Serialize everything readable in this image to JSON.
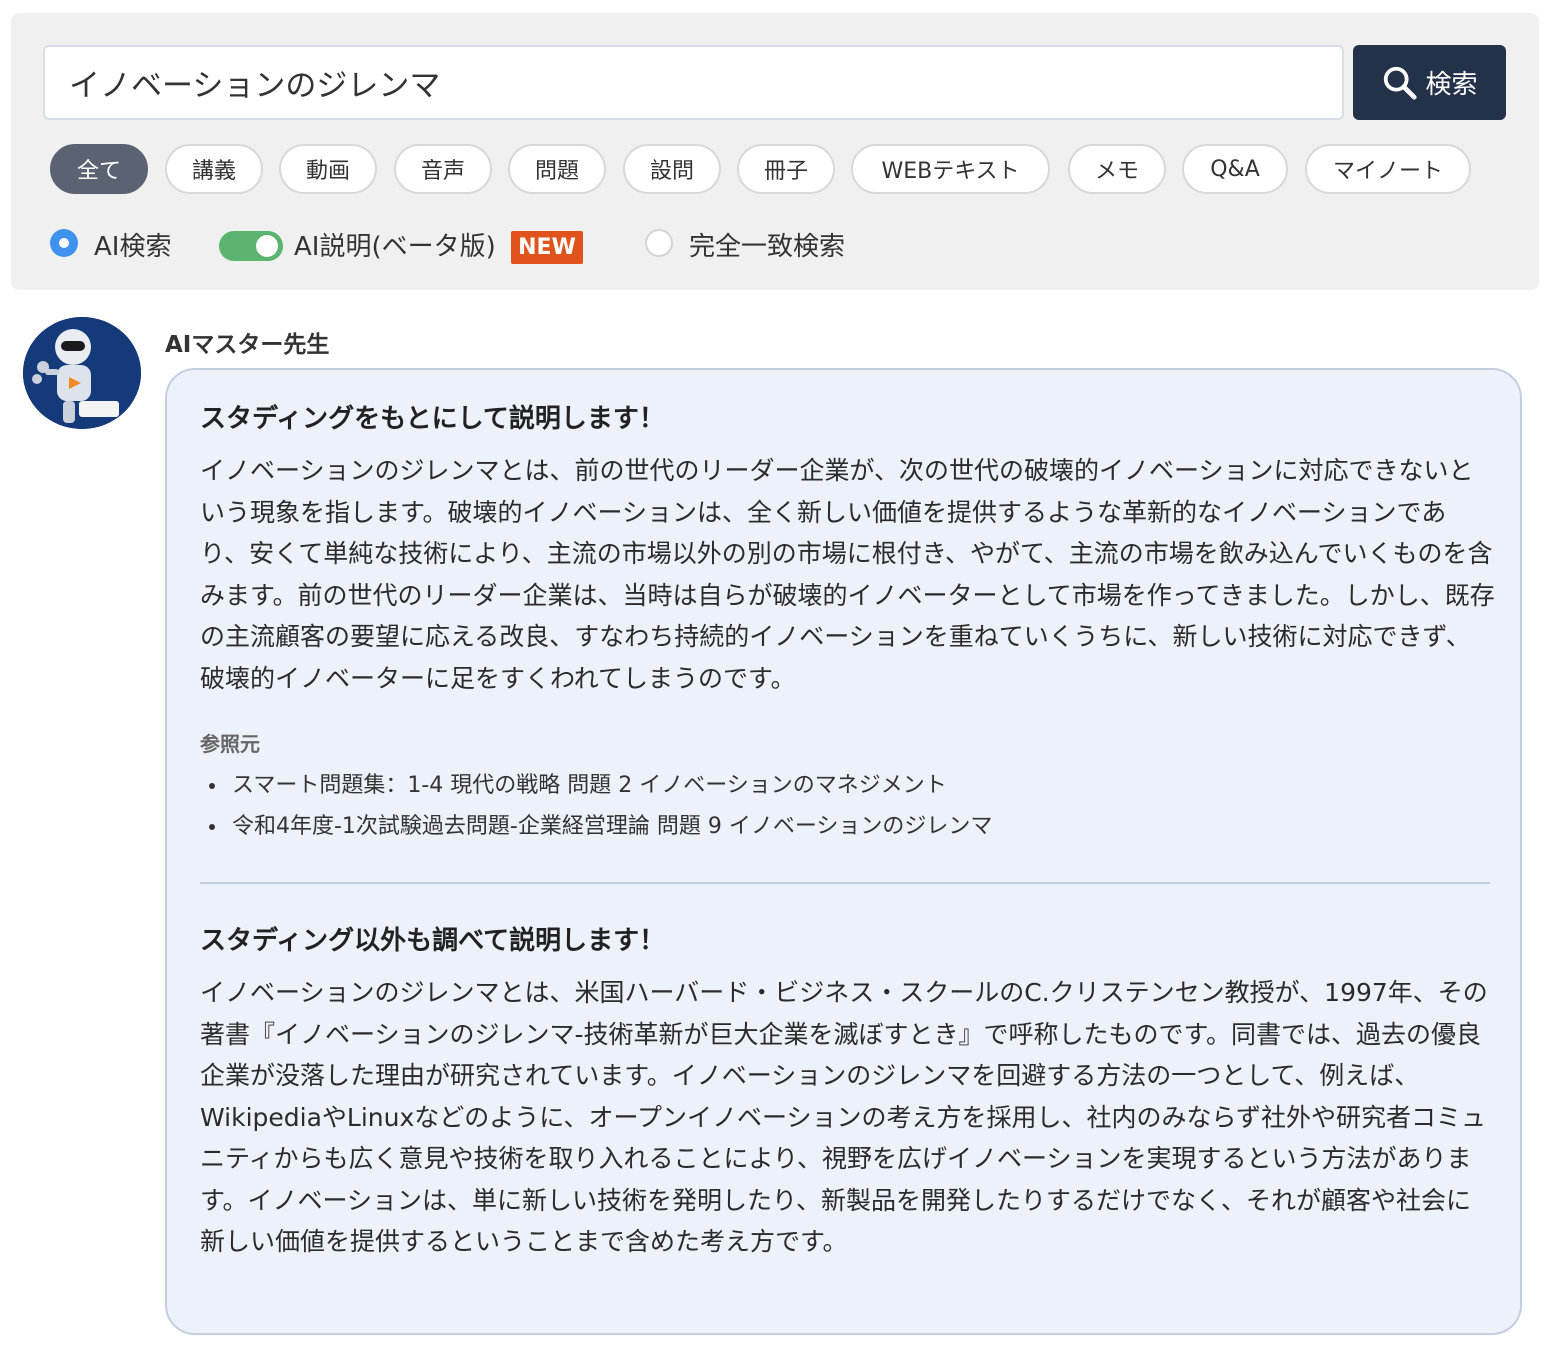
{
  "search": {
    "value": "イノベーションのジレンマ",
    "button_label": "検索"
  },
  "filters": [
    {
      "label": "全て",
      "active": true
    },
    {
      "label": "講義"
    },
    {
      "label": "動画"
    },
    {
      "label": "音声"
    },
    {
      "label": "問題"
    },
    {
      "label": "設問"
    },
    {
      "label": "冊子"
    },
    {
      "label": "WEBテキスト"
    },
    {
      "label": "メモ"
    },
    {
      "label": "Q&A"
    },
    {
      "label": "マイノート"
    }
  ],
  "options": {
    "ai_search_label": "AI検索",
    "ai_explain_label": "AI説明(ベータ版)",
    "new_badge": "NEW",
    "exact_match_label": "完全一致検索"
  },
  "answer": {
    "teacher_name": "AIマスター先生",
    "section1": {
      "heading": "スタディングをもとにして説明します！",
      "body": "イノベーションのジレンマとは、前の世代のリーダー企業が、次の世代の破壊的イノベーションに対応できないという現象を指します。破壊的イノベーションは、全く新しい価値を提供するような革新的なイノベーションであり、安くて単純な技術により、主流の市場以外の別の市場に根付き、やがて、主流の市場を飲み込んでいくものを含みます。前の世代のリーダー企業は、当時は自らが破壊的イノベーターとして市場を作ってきました。しかし、既存の主流顧客の要望に応える改良、すなわち持続的イノベーションを重ねていくうちに、新しい技術に対応できず、破壊的イノベーターに足をすくわれてしまうのです。"
    },
    "references": {
      "title": "参照元",
      "items": [
        "スマート問題集：1-4 現代の戦略 問題 2 イノベーションのマネジメント",
        "令和4年度-1次試験過去問題-企業経営理論 問題 9 イノベーションのジレンマ"
      ]
    },
    "section2": {
      "heading": "スタディング以外も調べて説明します！",
      "body": "イノベーションのジレンマとは、米国ハーバード・ビジネス・スクールのC.クリステンセン教授が、1997年、その著書『イノベーションのジレンマ-技術革新が巨大企業を滅ぼすとき』で呼称したものです。同書では、過去の優良企業が没落した理由が研究されています。イノベーションのジレンマを回避する方法の一つとして、例えば、WikipediaやLinuxなどのように、オープンイノベーションの考え方を採用し、社内のみならず社外や研究者コミュニティからも広く意見や技術を取り入れることにより、視野を広げイノベーションを実現するという方法があります。イノベーションは、単に新しい技術を発明したり、新製品を開発したりするだけでなく、それが顧客や社会に新しい価値を提供するということまで含めた考え方です。"
    }
  },
  "colors": {
    "search_button_bg": "#233249",
    "active_chip_bg": "#5b6271",
    "radio_on": "#3f93ee",
    "toggle_on": "#5bb46f",
    "new_badge_bg": "#e0531c",
    "card_bg": "#edf2fa"
  },
  "icons": {
    "search_button": "search-icon",
    "avatar": "robot-teacher-avatar"
  }
}
